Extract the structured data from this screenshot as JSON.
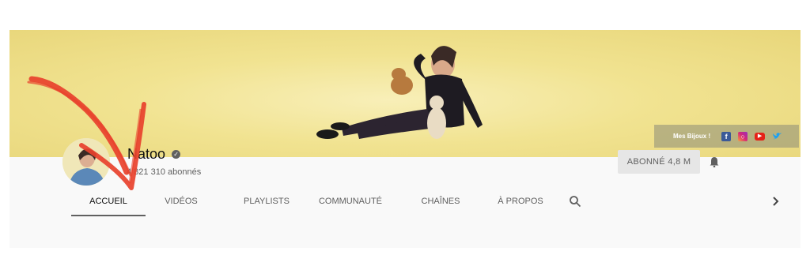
{
  "banner": {
    "links_label": "Mes Bijoux !",
    "social_icons": [
      "facebook-icon",
      "instagram-icon",
      "youtube-icon",
      "twitter-icon"
    ]
  },
  "channel": {
    "name": "Natoo",
    "subscribers": "4 821 310 abonnés"
  },
  "subscribe": {
    "label": "ABONNÉ  4,8 M"
  },
  "tabs": [
    {
      "label": "ACCUEIL",
      "active": true
    },
    {
      "label": "VIDÉOS"
    },
    {
      "label": "PLAYLISTS"
    },
    {
      "label": "COMMUNAUTÉ"
    },
    {
      "label": "CHAÎNES"
    },
    {
      "label": "À PROPOS"
    }
  ],
  "colors": {
    "banner": "#f1e391",
    "header_bg": "#f9f9f9",
    "subscribe_bg": "#e6e6e6",
    "annotation_arrow": "#e8412c"
  }
}
